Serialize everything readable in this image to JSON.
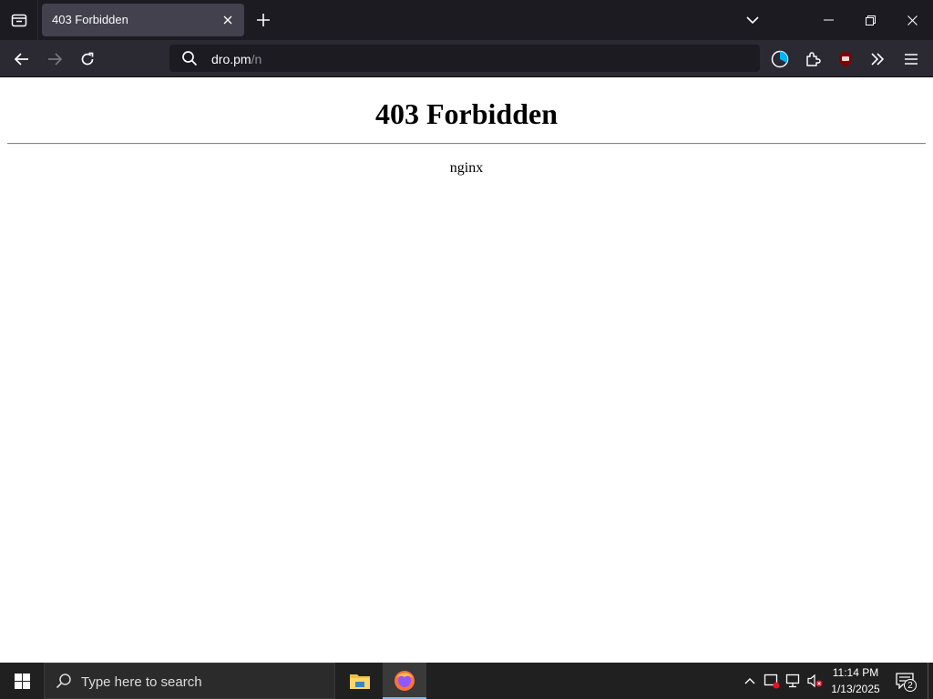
{
  "browser": {
    "tab": {
      "title": "403 Forbidden"
    },
    "url": {
      "host": "dro.pm",
      "path": "/n"
    }
  },
  "page": {
    "heading": "403 Forbidden",
    "server": "nginx"
  },
  "taskbar": {
    "search_placeholder": "Type here to search",
    "clock_time": "11:14 PM",
    "clock_date": "1/13/2025",
    "notification_count": "2"
  },
  "icons": {
    "list_all_tabs": "tab-list-icon",
    "close_tab": "close-icon",
    "new_tab": "plus-icon",
    "all_tabs": "chevron-down-icon",
    "minimize": "minimize-icon",
    "maximize": "restore-icon",
    "close_window": "close-icon",
    "back": "arrow-left-icon",
    "forward": "arrow-right-icon",
    "reload": "reload-icon",
    "search": "search-icon",
    "pie": "pie-chart-icon",
    "extensions": "puzzle-icon",
    "ublock": "ublock-icon",
    "overflow": "double-chevron-icon",
    "menu": "hamburger-icon",
    "start": "windows-icon",
    "explorer": "folder-icon",
    "firefox": "firefox-icon"
  },
  "colors": {
    "chrome_dark": "#1c1b22",
    "toolbar": "#2b2a33",
    "tab_active": "#42414d",
    "taskbar": "#202020",
    "accent": "#76b9ed"
  }
}
